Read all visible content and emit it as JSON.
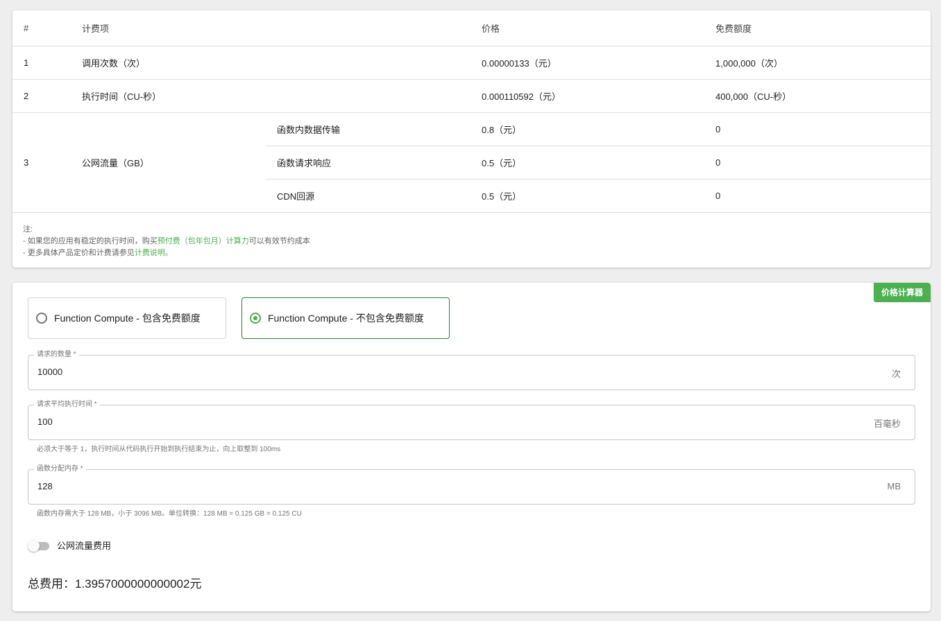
{
  "pricing_table": {
    "headers": [
      "#",
      "计费项",
      "价格",
      "免费额度"
    ],
    "rows": [
      {
        "num": "1",
        "item": "调用次数（次）",
        "price": "0.00000133（元）",
        "free": "1,000,000（次）"
      },
      {
        "num": "2",
        "item": "执行时间（CU-秒）",
        "price": "0.000110592（元）",
        "free": "400,000（CU-秒）"
      }
    ],
    "traffic": {
      "num": "3",
      "item": "公网流量（GB）",
      "subrows": [
        {
          "sub": "函数内数据传输",
          "price": "0.8（元）",
          "free": "0"
        },
        {
          "sub": "函数请求响应",
          "price": "0.5（元）",
          "free": "0"
        },
        {
          "sub": "CDN回源",
          "price": "0.5（元）",
          "free": "0"
        }
      ]
    }
  },
  "notes": {
    "title": "注:",
    "line1_prefix": "- 如果您的应用有稳定的执行时间，购买",
    "line1_link": "预付费（包年包月）计算力",
    "line1_suffix": "可以有效节约成本",
    "line2_prefix": "- 更多具体产品定价和计费请参见",
    "line2_link": "计费说明",
    "line2_suffix": "。"
  },
  "calculator": {
    "badge": "价格计算器",
    "options": [
      {
        "label": "Function Compute - 包含免费额度",
        "selected": false
      },
      {
        "label": "Function Compute - 不包含免费额度",
        "selected": true
      }
    ],
    "fields": {
      "requests": {
        "label": "请求的数量 *",
        "value": "10000",
        "unit": "次"
      },
      "exec_time": {
        "label": "请求平均执行时间 *",
        "value": "100",
        "unit": "百毫秒",
        "helper": "必须大于等于 1，执行时间从代码执行开始到执行结束为止，向上取整到 100ms"
      },
      "memory": {
        "label": "函数分配内存 *",
        "value": "128",
        "unit": "MB",
        "helper": "函数内存需大于 128 MB，小于 3096 MB。单位转换：128 MB = 0.125 GB = 0.125 CU"
      }
    },
    "traffic_toggle": {
      "label": "公网流量费用",
      "on": false
    },
    "total": "总费用：1.3957000000000002元"
  },
  "colors": {
    "accent": "#4caf50",
    "selected_border": "#2e7d32"
  }
}
